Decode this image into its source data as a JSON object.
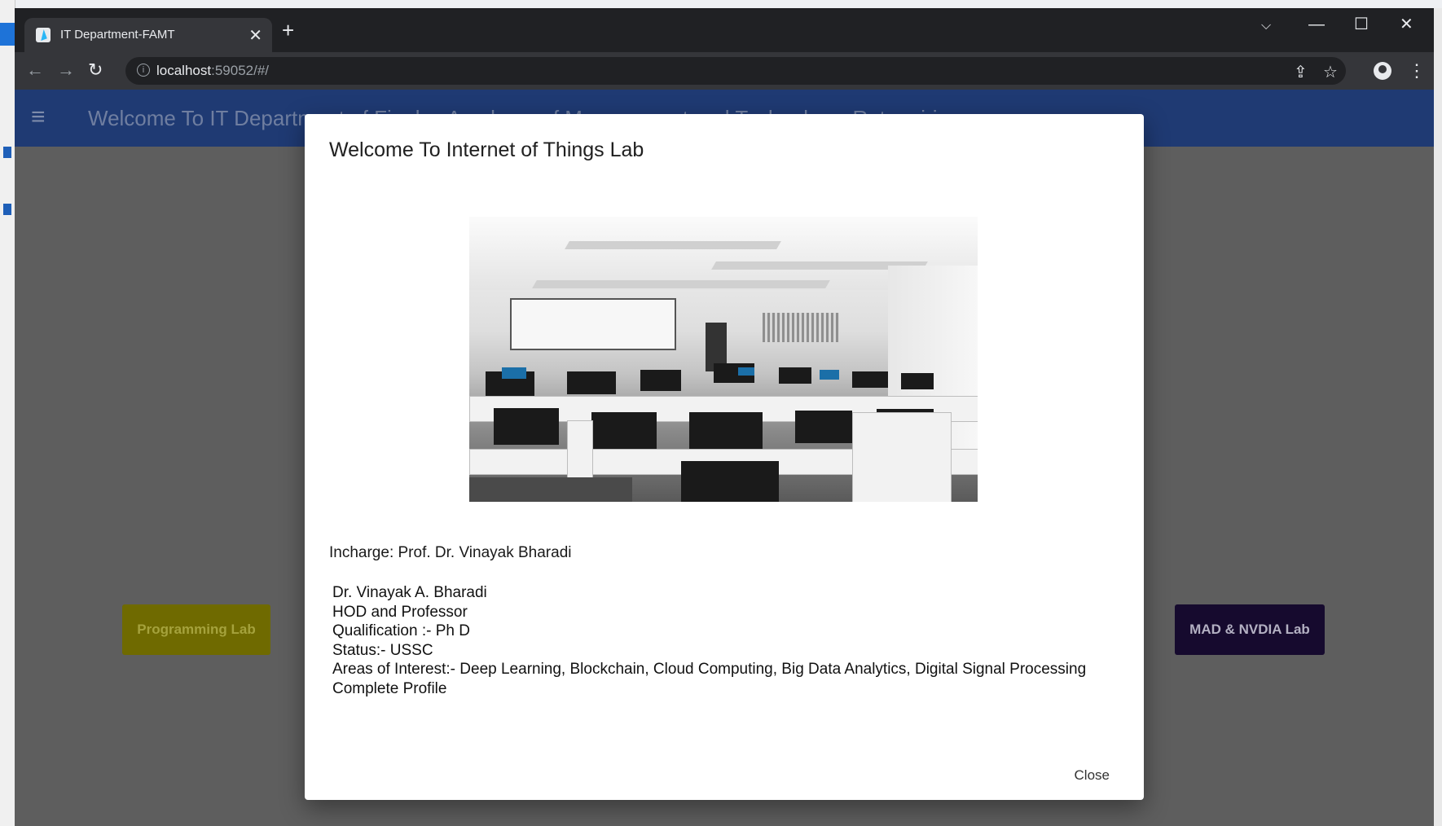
{
  "browser": {
    "tab_title": "IT Department-FAMT",
    "url_host": "localhost",
    "url_rest": ":59052/#/"
  },
  "app": {
    "appbar_title": "Welcome To IT Department of Finolex Academy of Management and Technology, Ratnagiri"
  },
  "lab_buttons": {
    "programming": "Programming Lab",
    "mad": "MAD & NVDIA Lab"
  },
  "dialog": {
    "title": "Welcome To Internet of Things Lab",
    "incharge": "Incharge: Prof. Dr. Vinayak Bharadi",
    "profile": {
      "name": "Dr. Vinayak A. Bharadi",
      "designation": "HOD and Professor",
      "qualification": "Qualification :- Ph D",
      "status": "Status:- USSC",
      "interests": "Areas of Interest:- Deep Learning, Blockchain, Cloud Computing, Big Data Analytics, Digital Signal Processing",
      "link": "Complete Profile"
    },
    "close_label": "Close"
  },
  "icons": {
    "back": "arrow-left-icon",
    "forward": "arrow-right-icon",
    "reload": "reload-icon",
    "share": "share-icon",
    "bookmark": "star-icon",
    "profile": "account-icon",
    "menu": "hamburger-icon"
  },
  "colors": {
    "appbar": "#2457a8",
    "programming_lab": "#b8b000",
    "mad_lab": "#26104a"
  }
}
